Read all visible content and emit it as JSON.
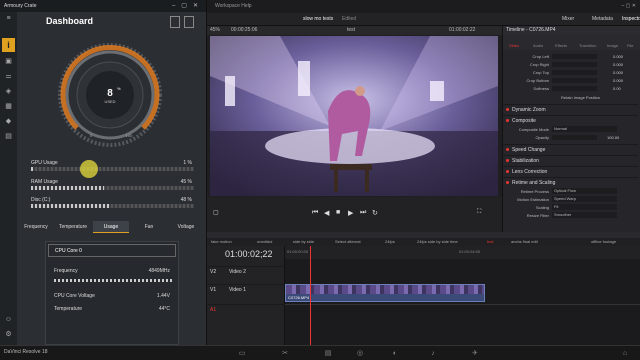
{
  "armoury": {
    "title": "Armoury Crate",
    "dashboard_title": "Dashboard",
    "gauge": {
      "value": "8",
      "unit": "%",
      "label": "USED",
      "scale_min": "0",
      "scale_max": "100",
      "fraction": 0.08
    },
    "bars": [
      {
        "label": "GPU Usage",
        "value": "1",
        "unit": "%",
        "fraction": 0.01
      },
      {
        "label": "RAM Usage",
        "value": "45",
        "unit": "%",
        "fraction": 0.45
      },
      {
        "label": "Disc (C:)",
        "value": "48",
        "unit": "%",
        "fraction": 0.48
      }
    ],
    "tabs": [
      "Frequency",
      "Temperature",
      "Usage",
      "Fan",
      "Voltage"
    ],
    "active_tab": "Usage",
    "card": {
      "title": "CPU Core 0",
      "rows": [
        {
          "label": "Frequency",
          "value": "4849MHz"
        },
        {
          "label": "CPU Core Voltage",
          "value": "1.44V"
        },
        {
          "label": "Temperature",
          "value": "44°C"
        }
      ]
    },
    "accent_color": "#e0a020"
  },
  "resolve": {
    "menu": "Workspace   Help",
    "project": "slow mo tests",
    "edited": "Edited",
    "zoom": "45%",
    "timecode_top": "00:00:25:06",
    "clip_label": "test",
    "source_tc": "01:00:02:22",
    "buttons": {
      "mixer": "Mixer",
      "metadata": "Metadata",
      "inspector": "Inspector"
    },
    "timeline_name": "Timeline - C0726.MP4",
    "inspector_tabs": [
      "Video",
      "Audio",
      "Effects",
      "Transition",
      "Image",
      "File"
    ],
    "crop": [
      {
        "label": "Crop Left",
        "value": "0.000"
      },
      {
        "label": "Crop Right",
        "value": "0.000"
      },
      {
        "label": "Crop Top",
        "value": "0.000"
      },
      {
        "label": "Crop Bottom",
        "value": "0.000"
      },
      {
        "label": "Softness",
        "value": "0.00"
      }
    ],
    "retain": "Retain Image Position",
    "sections": [
      "Dynamic Zoom",
      "Composite",
      "Speed Change",
      "Stabilization",
      "Lens Correction",
      "Retime and Scaling"
    ],
    "composite": {
      "mode_label": "Composite Mode",
      "mode_value": "Normal",
      "opacity_label": "Opacity",
      "opacity_value": "100.00"
    },
    "retime": [
      {
        "label": "Retime Process",
        "value": "Optical Flow"
      },
      {
        "label": "Motion Estimation",
        "value": "Speed Warp"
      },
      {
        "label": "Scaling",
        "value": "Fit"
      },
      {
        "label": "Resize Filter",
        "value": "Smoother"
      }
    ],
    "timeline_tabs": [
      "fake motion",
      "unedited",
      "side by side",
      "Select alternat",
      "24fps",
      "24fps side by side time",
      "test",
      "anchs final edit",
      "offline footage"
    ],
    "timecode_big": "01:00:02;22",
    "ruler": [
      "01:00:00:00",
      "01:00:04:00"
    ],
    "tracks": [
      {
        "id": "V2",
        "name": "Video 2"
      },
      {
        "id": "V1",
        "name": "Video 1"
      },
      {
        "id": "A1",
        "name": ""
      }
    ],
    "clip_name": "C0726.MP4"
  },
  "taskbar": {
    "app": "DaVinci Resolve 18"
  }
}
